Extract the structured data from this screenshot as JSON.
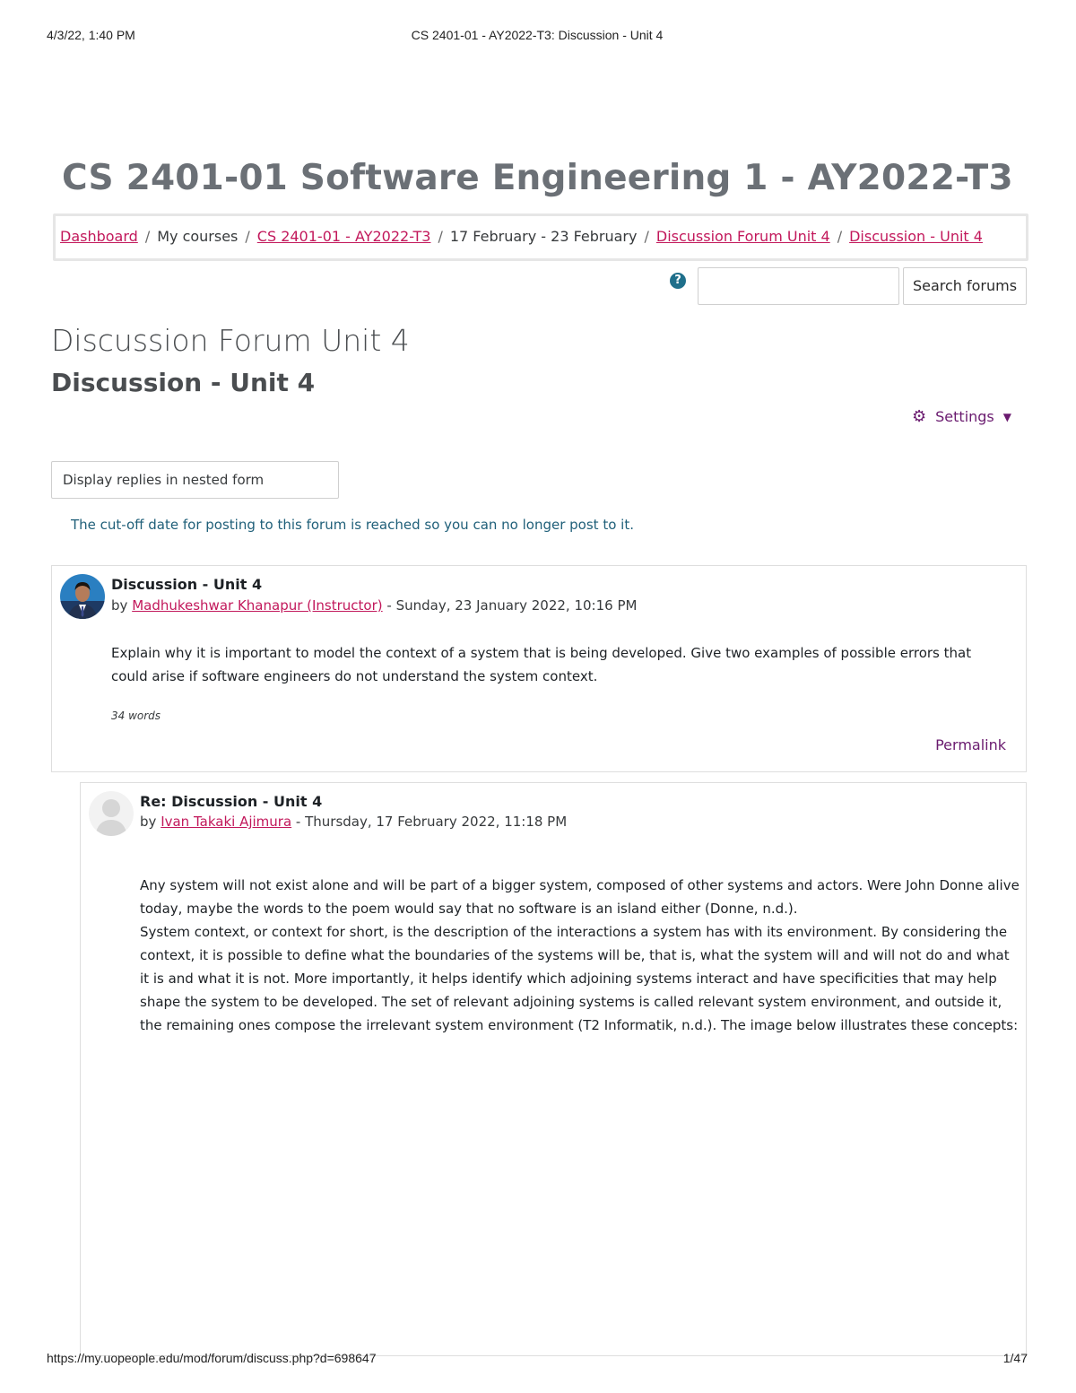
{
  "print_header": {
    "date": "4/3/22, 1:40 PM",
    "title": "CS 2401-01 - AY2022-T3: Discussion - Unit 4"
  },
  "course_title": "CS 2401-01 Software Engineering 1 - AY2022-T3",
  "breadcrumb": {
    "items": [
      "Dashboard",
      "My courses",
      "CS 2401-01 - AY2022-T3",
      "17 February - 23 February",
      "Discussion Forum Unit 4",
      "Discussion - Unit 4"
    ],
    "separator": "/"
  },
  "search": {
    "help_icon": "?",
    "input_value": "",
    "button_label": "Search forums"
  },
  "forum_title": "Discussion Forum Unit 4",
  "discussion_title": "Discussion - Unit 4",
  "settings": {
    "label": "Settings",
    "icon": "gear-icon"
  },
  "display_mode": "Display replies in nested form",
  "cutoff_notice": "The cut-off date for posting to this forum is reached so you can no longer post to it.",
  "posts": [
    {
      "subject": "Discussion - Unit 4",
      "by": "by",
      "author": "Madhukeshwar Khanapur (Instructor)",
      "date": "- Sunday, 23 January 2022, 10:16 PM",
      "body": "Explain why it is important to model the context of a system that is being developed. Give two examples of possible errors that could arise if software engineers do not understand the system context.",
      "word_count": "34 words",
      "permalink": "Permalink"
    },
    {
      "subject": "Re: Discussion - Unit 4",
      "by": "by",
      "author": "Ivan Takaki Ajimura",
      "date": "- Thursday, 17 February 2022, 11:18 PM",
      "body_paragraphs": [
        "Any system will not exist alone and will be part of a bigger system, composed of other systems and actors. Were John Donne alive today, maybe the words to the poem would say that no software is an island either (Donne, n.d.).",
        "System context, or context for short, is the description of the interactions a system has with its environment. By considering the context, it is possible to define what the boundaries of the systems will be, that is, what the system will and will not do and what it is and what it is not. More importantly, it helps identify which adjoining systems interact and have specificities that may help shape the system to be developed. The set of relevant adjoining systems is called relevant system environment, and outside it, the remaining ones compose the irrelevant system environment (T2 Informatik, n.d.). The image below illustrates these concepts:"
      ]
    }
  ],
  "print_footer": {
    "url": "https://my.uopeople.edu/mod/forum/discuss.php?d=698647",
    "page": "1/47"
  }
}
